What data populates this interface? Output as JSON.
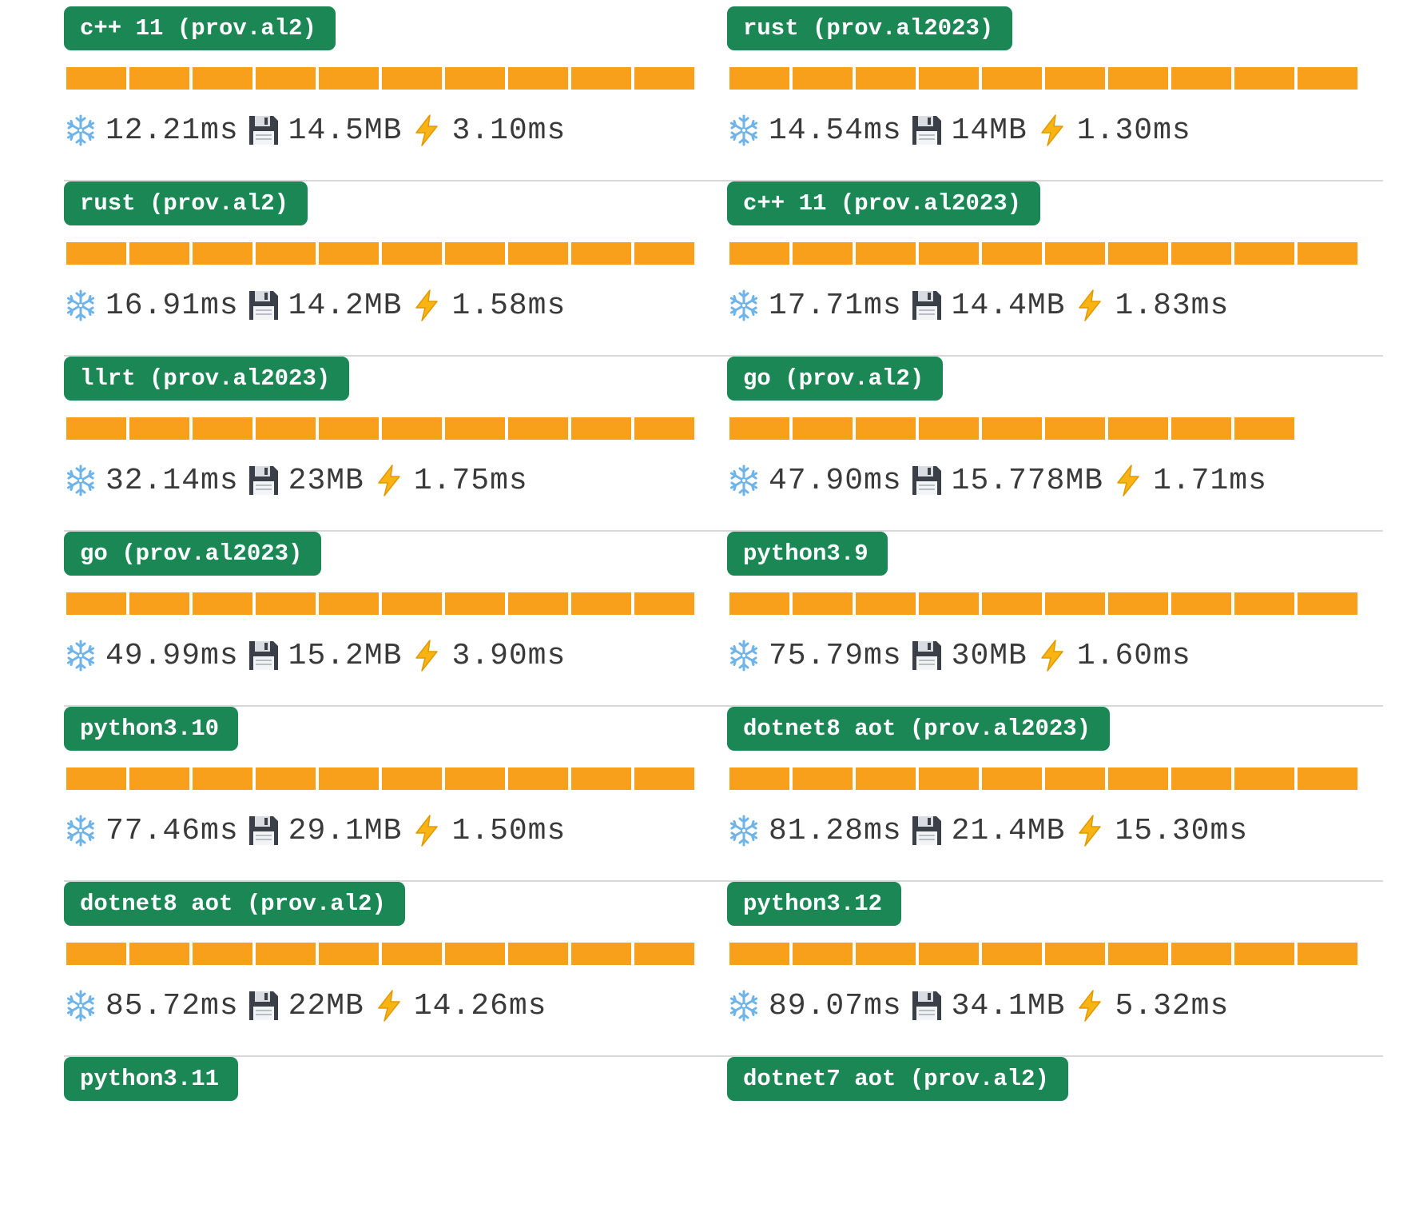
{
  "icons": {
    "cold_start": "snowflake-icon",
    "memory": "floppy-disk-icon",
    "duration": "lightning-bolt-icon"
  },
  "colors": {
    "badge": "#1a8754",
    "bar": "#f8a01c",
    "separator": "#d8d8d8"
  },
  "rows": [
    [
      {
        "name": "c++ 11 (prov.al2)",
        "bar_fill": 1.0,
        "cold": "12.21ms",
        "mem": "14.5MB",
        "dur": "3.10ms"
      },
      {
        "name": "rust (prov.al2023)",
        "bar_fill": 1.0,
        "cold": "14.54ms",
        "mem": "14MB",
        "dur": "1.30ms"
      }
    ],
    [
      {
        "name": "rust (prov.al2)",
        "bar_fill": 1.0,
        "cold": "16.91ms",
        "mem": "14.2MB",
        "dur": "1.58ms"
      },
      {
        "name": "c++ 11 (prov.al2023)",
        "bar_fill": 1.0,
        "cold": "17.71ms",
        "mem": "14.4MB",
        "dur": "1.83ms"
      }
    ],
    [
      {
        "name": "llrt (prov.al2023)",
        "bar_fill": 1.0,
        "cold": "32.14ms",
        "mem": "23MB",
        "dur": "1.75ms"
      },
      {
        "name": "go (prov.al2)",
        "bar_fill": 0.9,
        "cold": "47.90ms",
        "mem": "15.778MB",
        "dur": "1.71ms"
      }
    ],
    [
      {
        "name": "go (prov.al2023)",
        "bar_fill": 1.0,
        "cold": "49.99ms",
        "mem": "15.2MB",
        "dur": "3.90ms"
      },
      {
        "name": "python3.9",
        "bar_fill": 1.0,
        "cold": "75.79ms",
        "mem": "30MB",
        "dur": "1.60ms"
      }
    ],
    [
      {
        "name": "python3.10",
        "bar_fill": 1.0,
        "cold": "77.46ms",
        "mem": "29.1MB",
        "dur": "1.50ms"
      },
      {
        "name": "dotnet8 aot (prov.al2023)",
        "bar_fill": 1.0,
        "cold": "81.28ms",
        "mem": "21.4MB",
        "dur": "15.30ms"
      }
    ],
    [
      {
        "name": "dotnet8 aot (prov.al2)",
        "bar_fill": 1.0,
        "cold": "85.72ms",
        "mem": "22MB",
        "dur": "14.26ms"
      },
      {
        "name": "python3.12",
        "bar_fill": 1.0,
        "cold": "89.07ms",
        "mem": "34.1MB",
        "dur": "5.32ms"
      }
    ],
    [
      {
        "name": "python3.11"
      },
      {
        "name": "dotnet7 aot (prov.al2)"
      }
    ]
  ]
}
